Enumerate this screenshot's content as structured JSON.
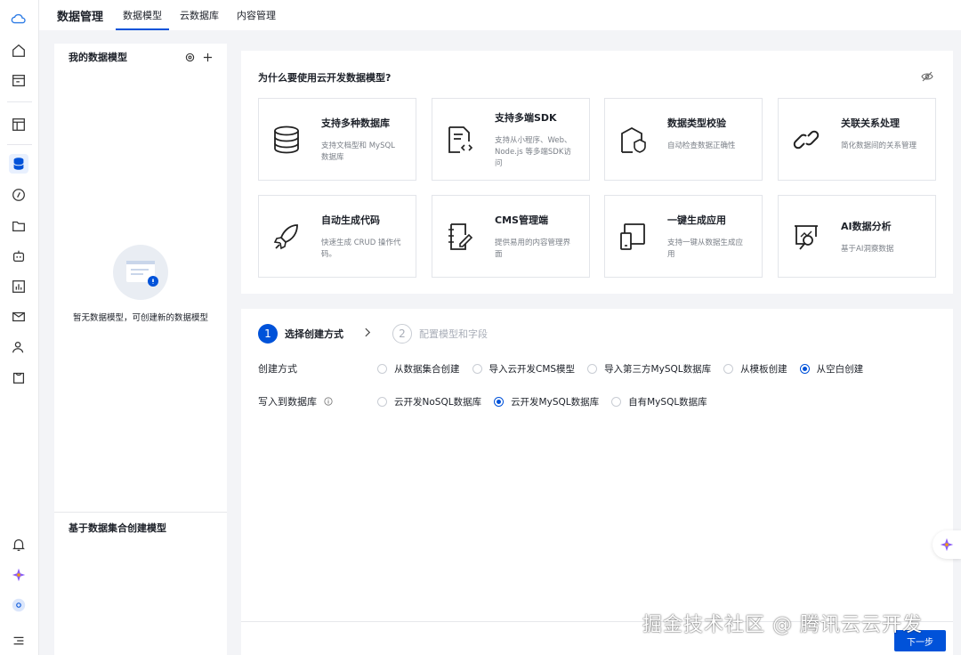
{
  "topbar": {
    "app_title": "数据管理",
    "tabs": [
      {
        "label": "数据模型",
        "active": true
      },
      {
        "label": "云数据库",
        "active": false
      },
      {
        "label": "内容管理",
        "active": false
      }
    ]
  },
  "rail": {
    "items": [
      "cloud-logo-icon",
      "home-icon",
      "dashboard-icon",
      "layout-icon",
      "database-icon",
      "compass-icon",
      "folder-icon",
      "robot-icon",
      "chart-icon",
      "mail-icon",
      "user-icon",
      "bag-icon",
      "bell-icon",
      "ai-spark-icon",
      "avatar-icon",
      "menu-icon"
    ],
    "active": "database-icon"
  },
  "left_panel": {
    "title": "我的数据模型",
    "settings_icon": "gear-icon",
    "add_icon": "plus-icon",
    "empty_text": "暂无数据模型，可创建新的数据模型",
    "bottom_title": "基于数据集合创建模型"
  },
  "why": {
    "title": "为什么要使用云开发数据模型?",
    "hide_icon": "eye-off-icon",
    "features": [
      {
        "name": "支持多种数据库",
        "desc": "支持文档型和 MySQL 数据库",
        "icon": "database-icon"
      },
      {
        "name": "支持多端SDK",
        "desc": "支持从小程序、Web、Node.js 等多端SDK访问",
        "icon": "code-doc-icon"
      },
      {
        "name": "数据类型校验",
        "desc": "自动检查数据正确性",
        "icon": "shield-icon"
      },
      {
        "name": "关联关系处理",
        "desc": "简化数据间的关系管理",
        "icon": "link-icon"
      },
      {
        "name": "自动生成代码",
        "desc": "快速生成 CRUD 操作代码。",
        "icon": "rocket-icon"
      },
      {
        "name": "CMS管理端",
        "desc": "提供易用的内容管理界面",
        "icon": "notebook-edit-icon"
      },
      {
        "name": "一键生成应用",
        "desc": "支持一键从数据生成应用",
        "icon": "devices-icon"
      },
      {
        "name": "AI数据分析",
        "desc": "基于AI洞察数据",
        "icon": "ai-analysis-icon"
      }
    ]
  },
  "create": {
    "steps": [
      {
        "num": "1",
        "label": "选择创建方式",
        "active": true
      },
      {
        "num": "2",
        "label": "配置模型和字段",
        "active": false
      }
    ],
    "method": {
      "label": "创建方式",
      "options": [
        {
          "label": "从数据集合创建",
          "checked": false
        },
        {
          "label": "导入云开发CMS模型",
          "checked": false
        },
        {
          "label": "导入第三方MySQL数据库",
          "checked": false
        },
        {
          "label": "从模板创建",
          "checked": false
        },
        {
          "label": "从空白创建",
          "checked": true
        }
      ]
    },
    "target": {
      "label": "写入到数据库",
      "info_icon": "info-icon",
      "options": [
        {
          "label": "云开发NoSQL数据库",
          "checked": false
        },
        {
          "label": "云开发MySQL数据库",
          "checked": true
        },
        {
          "label": "自有MySQL数据库",
          "checked": false
        }
      ]
    },
    "next_label": "下一步"
  },
  "watermark": "掘金技术社区 @ 腾讯云云开发",
  "colors": {
    "accent": "#0052d9",
    "background": "#f3f4f7"
  }
}
